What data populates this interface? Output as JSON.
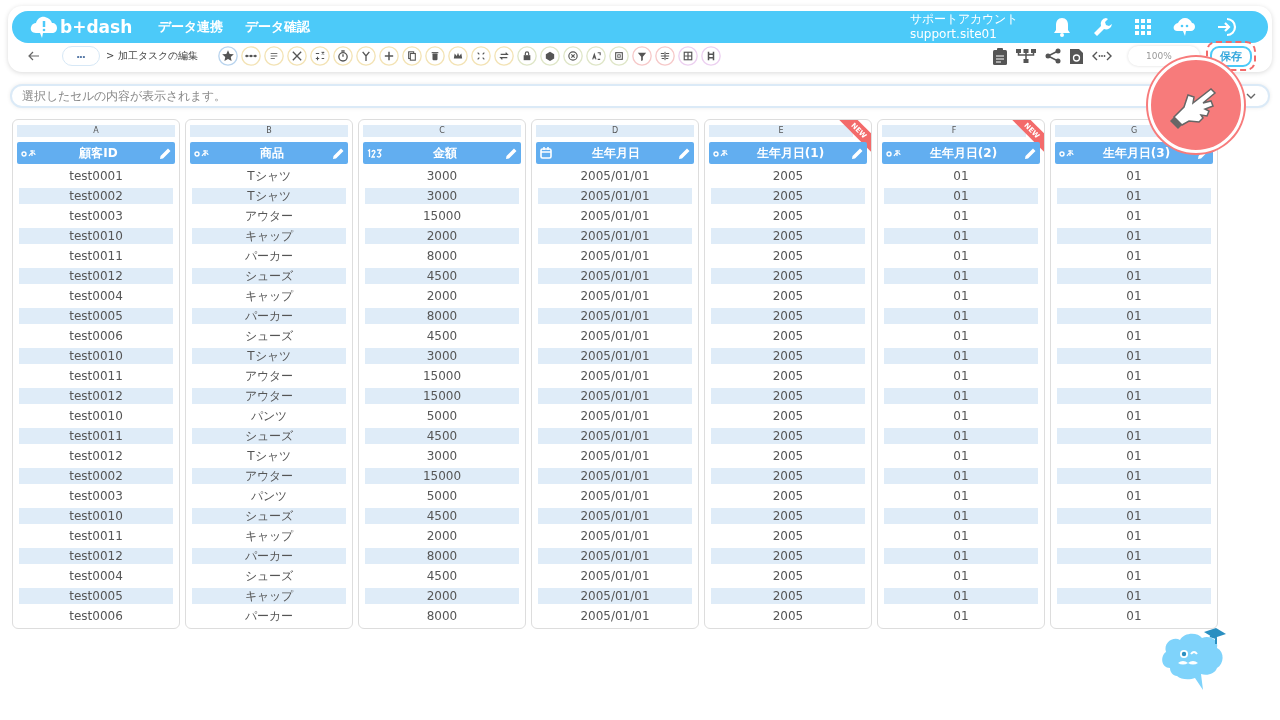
{
  "header": {
    "logo": "b+dash",
    "nav": [
      "データ連携",
      "データ確認"
    ],
    "account": {
      "name": "サポートアカウント",
      "id": "support.site01"
    }
  },
  "toolbar": {
    "more": "•••",
    "breadcrumb": "> 加工タスクの編集",
    "tools": [
      {
        "kind": "star",
        "color": "#b9d4ee"
      },
      {
        "kind": "dots",
        "color": "#f3e3b5"
      },
      {
        "kind": "lines",
        "color": "#f3e3b5"
      },
      {
        "kind": "scissors",
        "color": "#f3e3b5"
      },
      {
        "kind": "math",
        "color": "#f3e3b5"
      },
      {
        "kind": "timer",
        "color": "#f3e3b5"
      },
      {
        "kind": "branch",
        "color": "#f3e3b5"
      },
      {
        "kind": "plus",
        "color": "#f3e3b5"
      },
      {
        "kind": "copy",
        "color": "#f3e3b5"
      },
      {
        "kind": "trash",
        "color": "#f3e3b5"
      },
      {
        "kind": "crown",
        "color": "#f3e3b5"
      },
      {
        "kind": "compress",
        "color": "#f3e3b5"
      },
      {
        "kind": "swap",
        "color": "#f3e3b5"
      },
      {
        "kind": "lock",
        "color": "#dfe6c8"
      },
      {
        "kind": "box",
        "color": "#dfe6c8"
      },
      {
        "kind": "close",
        "color": "#dfe6c8"
      },
      {
        "kind": "translate",
        "color": "#dfe6c8"
      },
      {
        "kind": "square",
        "color": "#dfe6c8"
      },
      {
        "kind": "filter",
        "color": "#f6c9c9"
      },
      {
        "kind": "split",
        "color": "#f6c9c9"
      },
      {
        "kind": "grid",
        "color": "#ecd0f0"
      },
      {
        "kind": "columns",
        "color": "#ecd0f0"
      }
    ],
    "zoom": "100%",
    "save": "保存"
  },
  "cell_preview": {
    "placeholder": "選択したセルの内容が表示されます。"
  },
  "columns": [
    {
      "letter": "A",
      "kind": "text",
      "title": "顧客ID",
      "new": false,
      "cells": [
        "test0001",
        "test0002",
        "test0003",
        "test0010",
        "test0011",
        "test0012",
        "test0004",
        "test0005",
        "test0006",
        "test0010",
        "test0011",
        "test0012",
        "test0010",
        "test0011",
        "test0012",
        "test0002",
        "test0003",
        "test0010",
        "test0011",
        "test0012",
        "test0004",
        "test0005",
        "test0006"
      ]
    },
    {
      "letter": "B",
      "kind": "text",
      "title": "商品",
      "new": false,
      "cells": [
        "Tシャツ",
        "Tシャツ",
        "アウター",
        "キャップ",
        "パーカー",
        "シューズ",
        "キャップ",
        "パーカー",
        "シューズ",
        "Tシャツ",
        "アウター",
        "アウター",
        "パンツ",
        "シューズ",
        "Tシャツ",
        "アウター",
        "パンツ",
        "シューズ",
        "キャップ",
        "パーカー",
        "シューズ",
        "キャップ",
        "パーカー"
      ]
    },
    {
      "letter": "C",
      "kind": "number",
      "title": "金額",
      "new": false,
      "cells": [
        "3000",
        "3000",
        "15000",
        "2000",
        "8000",
        "4500",
        "2000",
        "8000",
        "4500",
        "3000",
        "15000",
        "15000",
        "5000",
        "4500",
        "3000",
        "15000",
        "5000",
        "4500",
        "2000",
        "8000",
        "4500",
        "2000",
        "8000"
      ]
    },
    {
      "letter": "D",
      "kind": "date",
      "title": "生年月日",
      "new": false,
      "cells": [
        "2005/01/01",
        "2005/01/01",
        "2005/01/01",
        "2005/01/01",
        "2005/01/01",
        "2005/01/01",
        "2005/01/01",
        "2005/01/01",
        "2005/01/01",
        "2005/01/01",
        "2005/01/01",
        "2005/01/01",
        "2005/01/01",
        "2005/01/01",
        "2005/01/01",
        "2005/01/01",
        "2005/01/01",
        "2005/01/01",
        "2005/01/01",
        "2005/01/01",
        "2005/01/01",
        "2005/01/01",
        "2005/01/01"
      ]
    },
    {
      "letter": "E",
      "kind": "text",
      "title": "生年月日(1)",
      "new": true,
      "badge": "NEW",
      "cells": [
        "2005",
        "2005",
        "2005",
        "2005",
        "2005",
        "2005",
        "2005",
        "2005",
        "2005",
        "2005",
        "2005",
        "2005",
        "2005",
        "2005",
        "2005",
        "2005",
        "2005",
        "2005",
        "2005",
        "2005",
        "2005",
        "2005",
        "2005"
      ]
    },
    {
      "letter": "F",
      "kind": "text",
      "title": "生年月日(2)",
      "new": true,
      "badge": "NEW",
      "cells": [
        "01",
        "01",
        "01",
        "01",
        "01",
        "01",
        "01",
        "01",
        "01",
        "01",
        "01",
        "01",
        "01",
        "01",
        "01",
        "01",
        "01",
        "01",
        "01",
        "01",
        "01",
        "01",
        "01"
      ]
    },
    {
      "letter": "G",
      "kind": "text",
      "title": "生年月日(3)",
      "new": false,
      "cells": [
        "01",
        "01",
        "01",
        "01",
        "01",
        "01",
        "01",
        "01",
        "01",
        "01",
        "01",
        "01",
        "01",
        "01",
        "01",
        "01",
        "01",
        "01",
        "01",
        "01",
        "01",
        "01",
        "01"
      ]
    }
  ]
}
